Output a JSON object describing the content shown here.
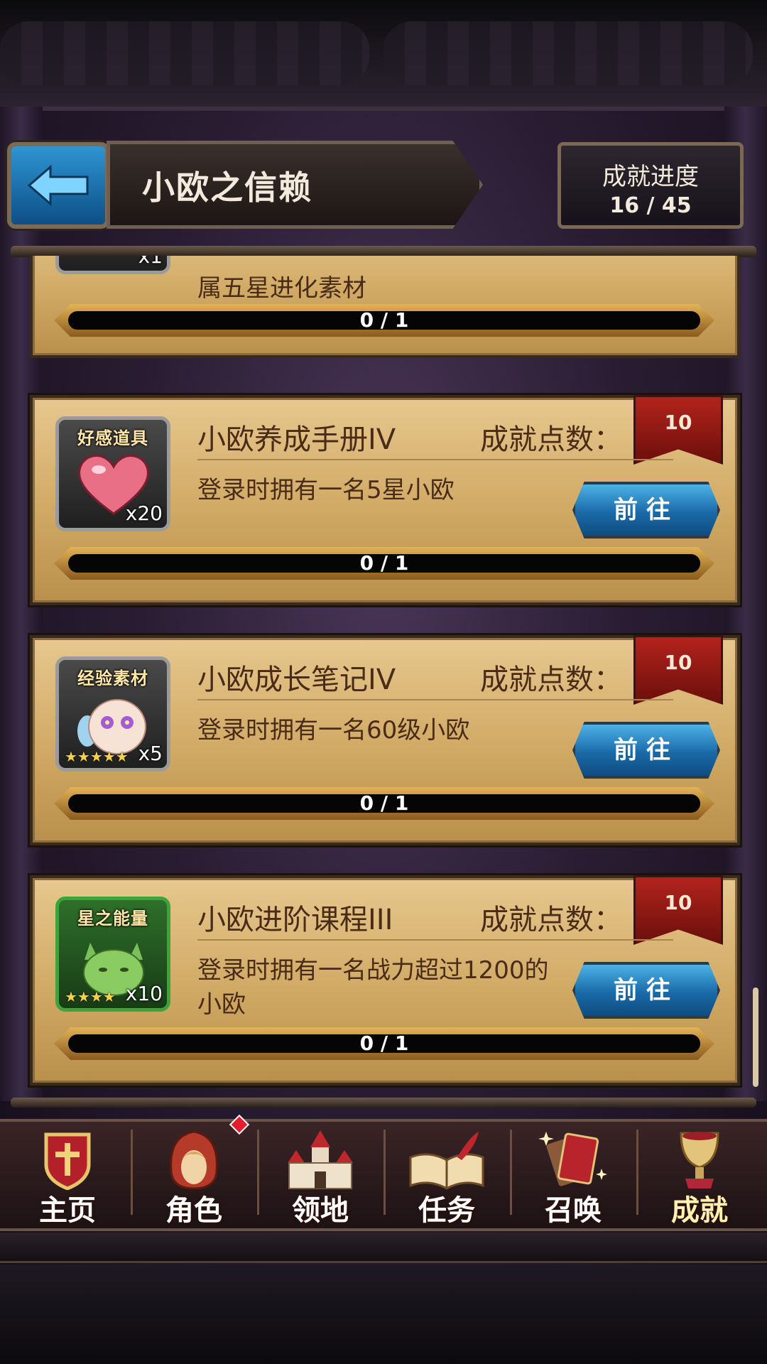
{
  "header": {
    "title": "小欧之信赖",
    "progress_label": "成就进度",
    "progress_value": "16 / 45",
    "back_icon": "back-arrow-icon"
  },
  "colors": {
    "card_bg": "#d9b775",
    "accent_blue": "#1a6aa8",
    "ribbon_red": "#b3231d",
    "text_brown": "#4a2b17"
  },
  "partial_card": {
    "count": "x1",
    "description": "属五星进化素材",
    "progress": "0 / 1"
  },
  "achievements": [
    {
      "title": "小欧养成手册IV",
      "points_label": "成就点数：",
      "points": "10",
      "description": "登录时拥有一名5星小欧",
      "go_label": "前往",
      "progress": "0 / 1",
      "icon_tag": "好感道具",
      "icon_count": "x20",
      "icon": "heart-icon"
    },
    {
      "title": "小欧成长笔记IV",
      "points_label": "成就点数：",
      "points": "10",
      "description": "登录时拥有一名60级小欧",
      "go_label": "前往",
      "progress": "0 / 1",
      "icon_tag": "经验素材",
      "icon_count": "x5",
      "icon_stars": "★★★★★",
      "icon": "exp-creature-icon"
    },
    {
      "title": "小欧进阶课程III",
      "points_label": "成就点数：",
      "points": "10",
      "description": "登录时拥有一名战力超过1200的小欧",
      "go_label": "前往",
      "progress": "0 / 1",
      "icon_tag": "星之能量",
      "icon_count": "x10",
      "icon_stars": "★★★★",
      "icon": "star-energy-cat-icon"
    }
  ],
  "nav": [
    {
      "label": "主页",
      "icon": "home-shield-icon"
    },
    {
      "label": "角色",
      "icon": "character-hood-icon"
    },
    {
      "label": "领地",
      "icon": "castle-icon"
    },
    {
      "label": "任务",
      "icon": "quest-book-icon"
    },
    {
      "label": "召唤",
      "icon": "summon-cards-icon"
    },
    {
      "label": "成就",
      "icon": "trophy-icon"
    }
  ]
}
